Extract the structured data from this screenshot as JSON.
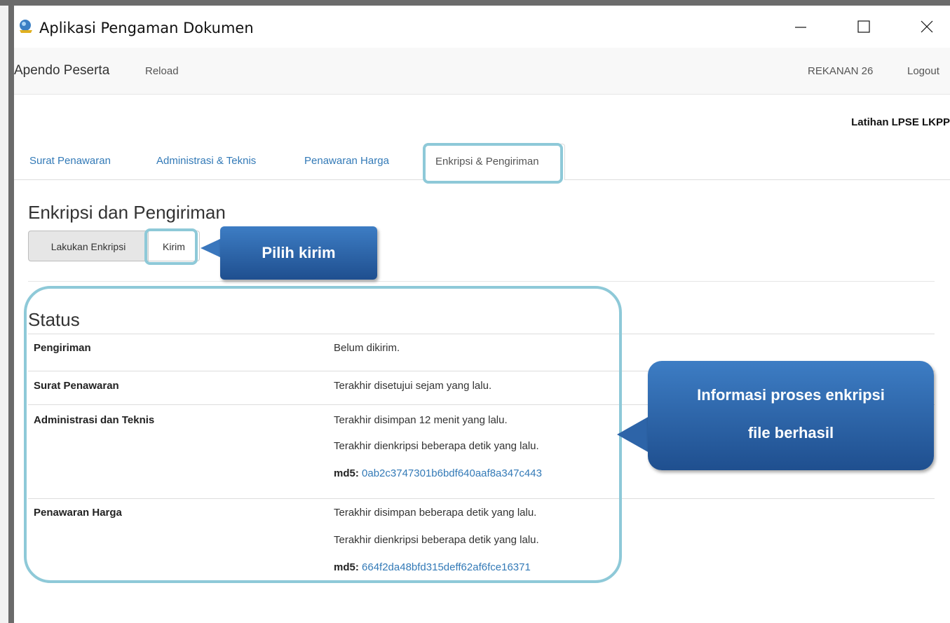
{
  "window": {
    "title": "Aplikasi Pengaman Dokumen"
  },
  "navbar": {
    "brand": "Apendo Peserta",
    "reload": "Reload",
    "user": "REKANAN 26",
    "logout": "Logout"
  },
  "org_name": "Latihan LPSE LKPP",
  "tabs": [
    {
      "label": "Surat Penawaran",
      "active": false
    },
    {
      "label": "Administrasi & Teknis",
      "active": false
    },
    {
      "label": "Penawaran Harga",
      "active": false
    },
    {
      "label": "Enkripsi & Pengiriman",
      "active": true
    }
  ],
  "page": {
    "heading": "Enkripsi dan Pengiriman",
    "buttons": {
      "enkripsi": "Lakukan Enkripsi",
      "kirim": "Kirim"
    }
  },
  "status": {
    "heading": "Status",
    "rows": [
      {
        "label": "Pengiriman",
        "lines": [
          "Belum dikirim."
        ]
      },
      {
        "label": "Surat Penawaran",
        "lines": [
          "Terakhir disetujui sejam yang lalu."
        ]
      },
      {
        "label": "Administrasi dan Teknis",
        "lines": [
          "Terakhir disimpan 12 menit yang lalu.",
          "Terakhir dienkripsi beberapa detik yang lalu."
        ],
        "md5_label": "md5:",
        "md5": "0ab2c3747301b6bdf640aaf8a347c443"
      },
      {
        "label": "Penawaran Harga",
        "lines": [
          "Terakhir disimpan beberapa detik yang lalu.",
          "Terakhir dienkripsi beberapa detik yang lalu."
        ],
        "md5_label": "md5:",
        "md5": "664f2da48bfd315deff62af6fce16371"
      }
    ]
  },
  "annotations": {
    "callout_kirim": "Pilih kirim",
    "callout_status_line1": "Informasi proses enkripsi",
    "callout_status_line2": "file berhasil"
  },
  "colors": {
    "link": "#337ab7",
    "highlight": "#8ec9d8",
    "callout": "#2d64a8"
  }
}
